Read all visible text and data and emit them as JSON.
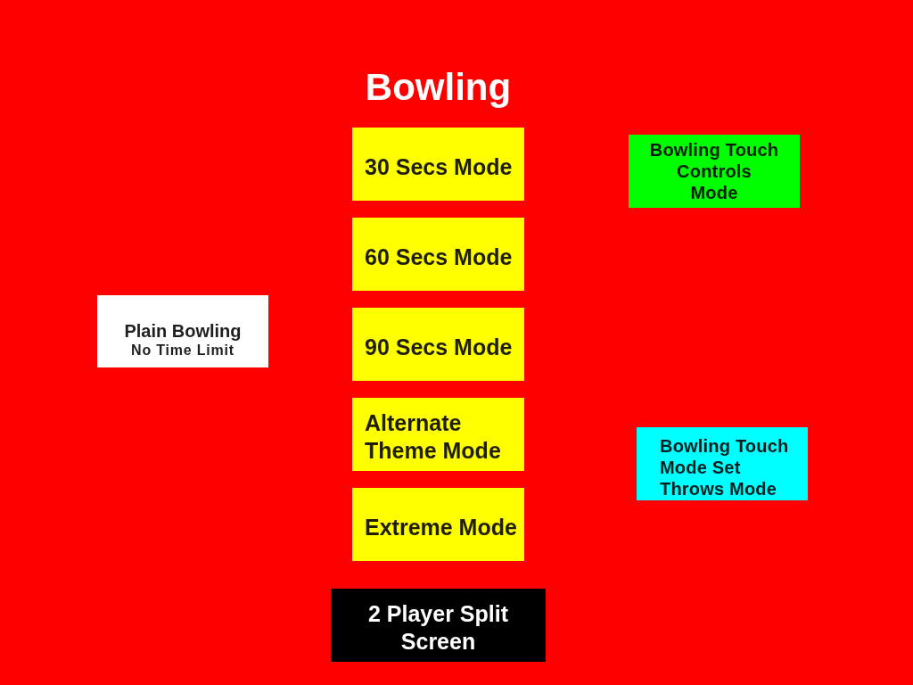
{
  "title": "Bowling",
  "left_column": [
    {
      "lines": [
        "Plain Bowling"
      ],
      "sublabel": "No Time Limit",
      "color": "#ffffff"
    }
  ],
  "center_column": [
    {
      "kind": "mode",
      "lines": [
        "30 Secs Mode"
      ],
      "color": "#ffff00"
    },
    {
      "kind": "mode",
      "lines": [
        "60 Secs Mode"
      ],
      "color": "#ffff00"
    },
    {
      "kind": "mode",
      "lines": [
        "90 Secs Mode"
      ],
      "color": "#ffff00"
    },
    {
      "kind": "mode",
      "lines": [
        "Alternate",
        "Theme Mode"
      ],
      "color": "#ffff00"
    },
    {
      "kind": "mode",
      "lines": [
        "Extreme Mode"
      ],
      "color": "#ffff00"
    },
    {
      "kind": "wide",
      "lines": [
        "2 Player Split",
        "Screen"
      ],
      "color": "#000000"
    }
  ],
  "right_column": [
    {
      "lines": [
        "Bowling Touch",
        "Controls",
        "Mode"
      ],
      "color": "#00ff00"
    },
    {
      "lines": [
        "Bowling Touch",
        "Mode Set",
        "Throws Mode"
      ],
      "color": "#00ffff"
    }
  ]
}
